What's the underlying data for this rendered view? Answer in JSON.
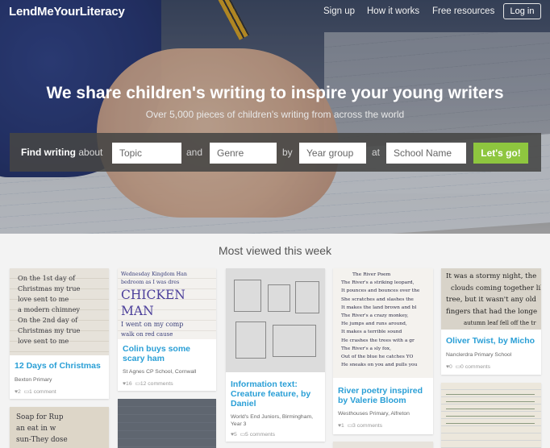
{
  "header": {
    "logo": "LendMeYourLiteracy",
    "nav": [
      "Sign up",
      "How it works",
      "Free resources"
    ],
    "login": "Log in"
  },
  "hero": {
    "headline": "We share children's writing to inspire your young writers",
    "subhead": "Over 5,000 pieces of children's writing from across the world"
  },
  "search": {
    "label_bold": "Find writing",
    "label_rest": "about",
    "topic_placeholder": "Topic",
    "and": "and",
    "genre_placeholder": "Genre",
    "by": "by",
    "year_placeholder": "Year group",
    "at": "at",
    "school_placeholder": "School Name",
    "go": "Let's go!"
  },
  "section": {
    "title": "Most viewed this week"
  },
  "cards": [
    {
      "title": "12 Days of Christmas",
      "school": "Bexton Primary",
      "views": "2",
      "comments": "1 comment",
      "hw": [
        "On the 1st day of",
        "Christmas my true",
        "love sent to me",
        "a modern chimney",
        "On the 2nd day of",
        "Christmas my true",
        "love sent to me"
      ]
    },
    {
      "title": "Colin buys some scary ham",
      "school": "St Agnes CP School, Cornwall",
      "views": "16",
      "comments": "12 comments",
      "hw": [
        "Wednesday Kingdom Han",
        "bedroom as I was dres",
        "CHICKEN MAN",
        "I went on my comp",
        "walk on red cause"
      ]
    },
    {
      "title": "Information text: Creature feature, by Daniel",
      "school": "World's End Juniors, Birmingham, Year 3",
      "views": "5",
      "comments": "5 comments"
    },
    {
      "title": "River poetry inspired by Valerie Bloom",
      "school": "Westhouses Primary, Alfreton",
      "views": "1",
      "comments": "3 comments",
      "hw": [
        "The River Poem",
        "The River's a striking leopard,",
        "It pounces and bounces over the",
        "She scratches and slashes the",
        "It makes the land brown and bl",
        "The River's a crazy monkey,",
        "He jumps and runs around,",
        "It makes a terrible sound",
        "He crashes the trees with a gr",
        "The River's a sly fox,",
        "Out of the blue he catches YO",
        "He sneaks on you and pulls you"
      ]
    },
    {
      "title": "Oliver Twist, by Micho",
      "school": "Nanclerdra Primary School",
      "views": "0",
      "comments": "0 comments",
      "hw": [
        "It was a stormy night, the",
        "clouds coming together like",
        "tree, but it wasn't any old",
        "fingers that had the longe",
        "autumn leaf fell off the tr"
      ]
    }
  ],
  "bottom": {
    "hw1": [
      "Soap for Rup",
      "an eat in w",
      "sun-They dose"
    ]
  }
}
